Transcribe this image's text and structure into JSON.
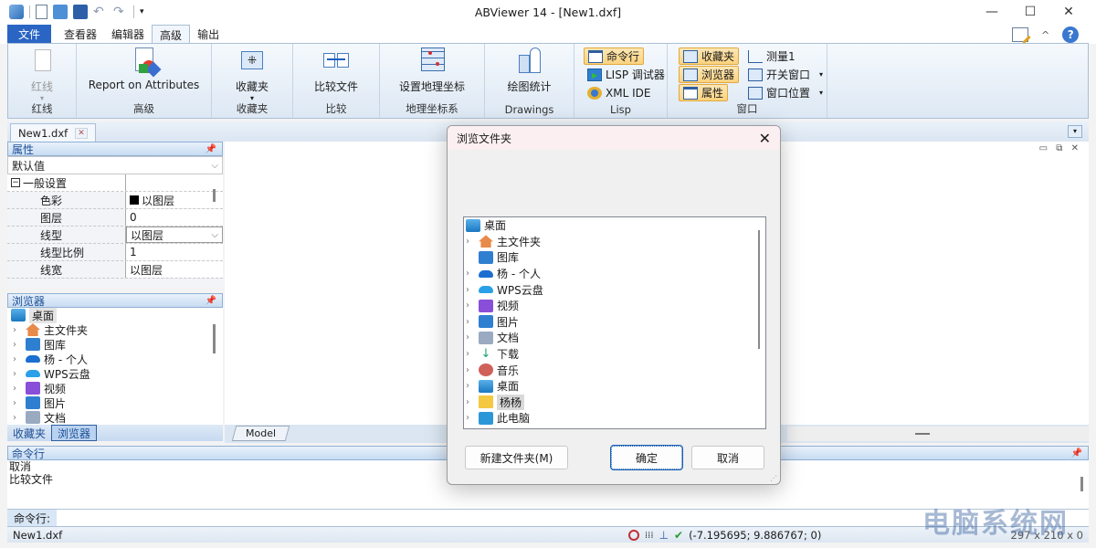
{
  "app": {
    "title": "ABViewer 14 - [New1.dxf]"
  },
  "quick_access": [
    "app-icon",
    "new-icon",
    "open-icon",
    "save-icon",
    "undo-icon",
    "redo-icon",
    "customize-icon"
  ],
  "window_controls": {
    "minimize": "—",
    "maximize": "☐",
    "close": "✕"
  },
  "ribbon_tabs": [
    {
      "label": "文件"
    },
    {
      "label": "查看器"
    },
    {
      "label": "编辑器"
    },
    {
      "label": "高级"
    },
    {
      "label": "输出"
    }
  ],
  "ribbon_right": {
    "style_icon": "style-icon",
    "collapse": "^",
    "help": "?"
  },
  "ribbon_groups": {
    "redline": {
      "button": "红线",
      "label": "红线"
    },
    "advanced": {
      "button": "Report on Attributes",
      "label": "高级"
    },
    "favorites": {
      "button": "收藏夹",
      "label": "收藏夹"
    },
    "compare": {
      "button": "比较文件",
      "label": "比较"
    },
    "geo": {
      "button": "设置地理坐标",
      "label": "地理坐标系"
    },
    "drawings": {
      "button": "绘图统计",
      "label": "Drawings"
    },
    "lisp": {
      "items": [
        "命令行",
        "LISP 调试器",
        "XML IDE"
      ],
      "label": "Lisp"
    },
    "window": {
      "left": [
        "收藏夹",
        "浏览器",
        "属性"
      ],
      "right": [
        "测量1",
        "开关窗口",
        "窗口位置"
      ],
      "label": "窗口"
    }
  },
  "doc_tab": {
    "label": "New1.dxf",
    "close": "✕"
  },
  "properties": {
    "title": "属性",
    "selector": "默认值",
    "section": "一般设置",
    "rows": [
      {
        "key": "色彩",
        "value": "以图层"
      },
      {
        "key": "图层",
        "value": "0"
      },
      {
        "key": "线型",
        "value": "以图层"
      },
      {
        "key": "线型比例",
        "value": "1"
      },
      {
        "key": "线宽",
        "value": "以图层"
      }
    ]
  },
  "browser": {
    "title": "浏览器",
    "root": "桌面",
    "items": [
      "主文件夹",
      "图库",
      "杨 - 个人",
      "WPS云盘",
      "视频",
      "图片",
      "文档"
    ],
    "tabs": [
      "收藏夹",
      "浏览器"
    ]
  },
  "layout_tabs": [
    "Model"
  ],
  "command": {
    "title": "命令行",
    "lines": [
      "取消",
      "比较文件"
    ],
    "prompt": "命令行:"
  },
  "status": {
    "file": "New1.dxf",
    "coords": "(-7.195695; 9.886767; 0)",
    "size": "297 x 210 x 0"
  },
  "dialog": {
    "title": "浏览文件夹",
    "root": "桌面",
    "items": [
      {
        "label": "主文件夹",
        "icon": "home",
        "chev": true
      },
      {
        "label": "图库",
        "icon": "gallery",
        "chev": false
      },
      {
        "label": "杨 - 个人",
        "icon": "onedrive",
        "chev": true
      },
      {
        "label": "WPS云盘",
        "icon": "cloud",
        "chev": true
      },
      {
        "label": "视频",
        "icon": "video",
        "chev": true
      },
      {
        "label": "图片",
        "icon": "pictures",
        "chev": true
      },
      {
        "label": "文档",
        "icon": "docs",
        "chev": true
      },
      {
        "label": "下载",
        "icon": "download",
        "chev": true
      },
      {
        "label": "音乐",
        "icon": "music",
        "chev": true
      },
      {
        "label": "桌面",
        "icon": "desktop",
        "chev": true
      },
      {
        "label": "杨杨",
        "icon": "folder",
        "chev": true,
        "selected": true
      },
      {
        "label": "此电脑",
        "icon": "pc",
        "chev": true
      }
    ],
    "new_folder": "新建文件夹(M)",
    "ok": "确定",
    "cancel": "取消"
  },
  "watermark": "电脑系统网"
}
